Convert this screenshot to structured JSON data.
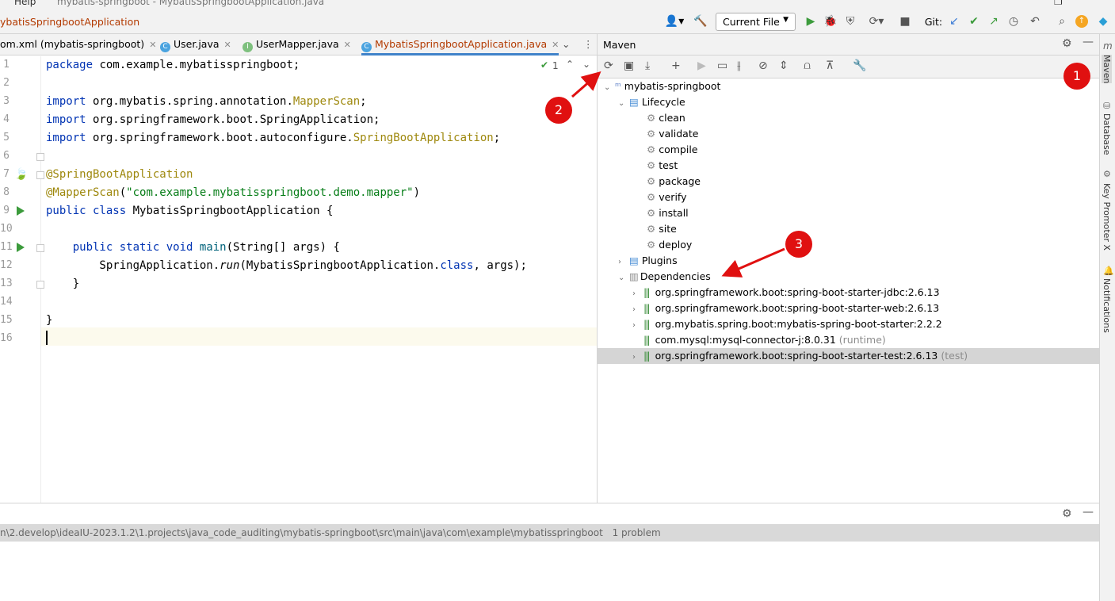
{
  "window": {
    "menu_help": "Help",
    "title": "mybatis-springboot - MybatisSpringbootApplication.java"
  },
  "navbar": {
    "breadcrumb": "ybatisSpringbootApplication",
    "run_config": "Current File",
    "git_label": "Git:"
  },
  "tabs": [
    {
      "label": "om.xml (mybatis-springboot)",
      "icon": "m"
    },
    {
      "label": "User.java",
      "icon": "C"
    },
    {
      "label": "UserMapper.java",
      "icon": "I"
    },
    {
      "label": "MybatisSpringbootApplication.java",
      "icon": "C"
    }
  ],
  "editor": {
    "problems_count": "1",
    "line_numbers": [
      "1",
      "2",
      "3",
      "4",
      "5",
      "6",
      "7",
      "8",
      "9",
      "10",
      "11",
      "12",
      "13",
      "14",
      "15",
      "16"
    ]
  },
  "maven": {
    "title": "Maven",
    "project": "mybatis-springboot",
    "lifecycle_label": "Lifecycle",
    "lifecycle": [
      "clean",
      "validate",
      "compile",
      "test",
      "package",
      "verify",
      "install",
      "site",
      "deploy"
    ],
    "plugins_label": "Plugins",
    "dependencies_label": "Dependencies",
    "dependencies": [
      {
        "name": "org.springframework.boot:spring-boot-starter-jdbc:2.6.13",
        "scope": ""
      },
      {
        "name": "org.springframework.boot:spring-boot-starter-web:2.6.13",
        "scope": ""
      },
      {
        "name": "org.mybatis.spring.boot:mybatis-spring-boot-starter:2.2.2",
        "scope": ""
      },
      {
        "name": "com.mysql:mysql-connector-j:8.0.31",
        "scope": "(runtime)"
      },
      {
        "name": "org.springframework.boot:spring-boot-starter-test:2.6.13",
        "scope": "(test)"
      }
    ]
  },
  "side_tools": [
    "Maven",
    "Database",
    "Key Promoter X",
    "Notifications"
  ],
  "status": {
    "path": "n\\2.develop\\ideaIU-2023.1.2\\1.projects\\java_code_auditing\\mybatis-springboot\\src\\main\\java\\com\\example\\mybatisspringboot",
    "problems": "1 problem"
  },
  "annotations": [
    "1",
    "2",
    "3"
  ],
  "colors": {
    "accent": "#4083c9",
    "badge": "#e01010",
    "run": "#3c9b3c"
  }
}
